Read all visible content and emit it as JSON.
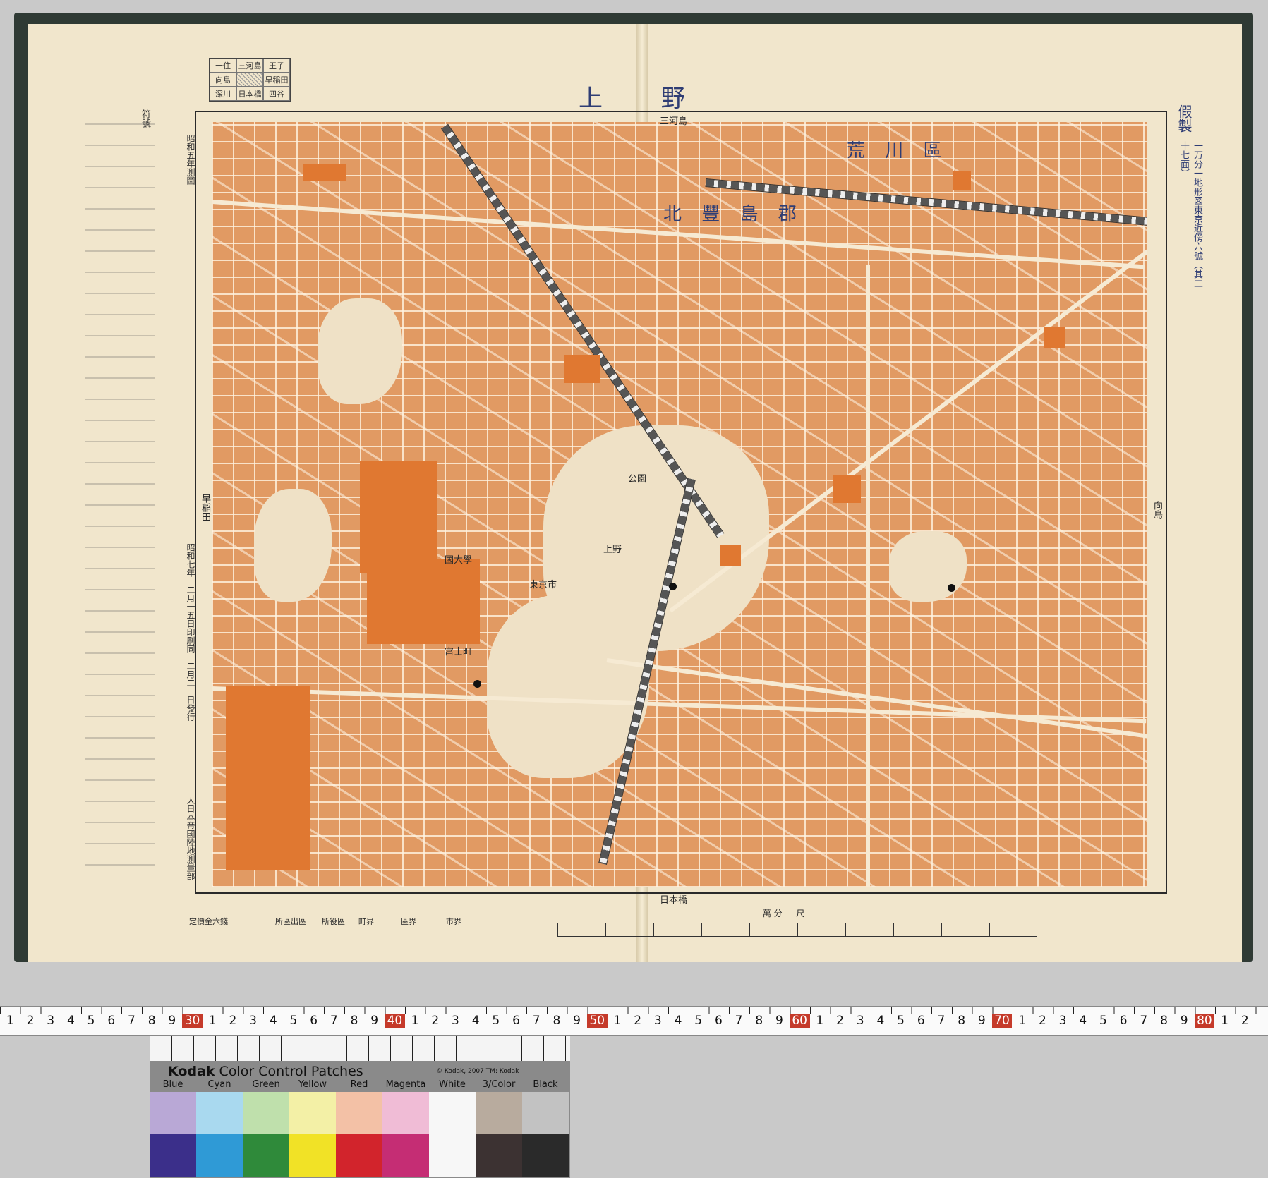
{
  "map": {
    "title": "上 野",
    "subtitle": "一万分一地形図東京近傍六號（其二十七面）",
    "header_right": "假製",
    "edge_labels": {
      "top": "三河島",
      "bottom": "日本橋",
      "left": "早稲田",
      "right": "向島"
    },
    "ward_labels": [
      "荒 川 區",
      "北 豐 島 郡"
    ],
    "district_labels": [
      "東京市",
      "上野",
      "公園",
      "富士町",
      "國大學"
    ],
    "publisher": "大日本帝國陸地測量部",
    "survey_note": "昭和五年測圖",
    "print_note": "昭和七年十二月十五日印刷同十二月二十日發行",
    "price_note": "定價金六錢",
    "scale_label": "一 萬 分 一 尺",
    "index_cells": [
      "十住",
      "三河島",
      "王子",
      "向島",
      "",
      "早稲田",
      "深川",
      "日本橋",
      "四谷"
    ],
    "legend_header": "符號",
    "bottom_legend": [
      "市界",
      "區界",
      "町界",
      "所役區",
      "所區出區"
    ]
  },
  "ruler": {
    "numbers": [
      "1",
      "2",
      "3",
      "4",
      "5",
      "6",
      "7",
      "8",
      "9",
      "30",
      "1",
      "2",
      "3",
      "4",
      "5",
      "6",
      "7",
      "8",
      "9",
      "40",
      "1",
      "2",
      "3",
      "4",
      "5",
      "6",
      "7",
      "8",
      "9",
      "50",
      "1",
      "2",
      "3",
      "4",
      "5",
      "6",
      "7",
      "8",
      "9",
      "60",
      "1",
      "2",
      "3",
      "4",
      "5",
      "6",
      "7",
      "8",
      "9",
      "70",
      "1",
      "2",
      "3",
      "4",
      "5",
      "6",
      "7",
      "8",
      "9",
      "80",
      "1",
      "2"
    ]
  },
  "kodak": {
    "brand": "Kodak",
    "product": "Color Control Patches",
    "copyright": "© Kodak, 2007 TM: Kodak",
    "patches": [
      {
        "name": "Blue",
        "light": "#b9a8d6",
        "dark": "#3b2f8a"
      },
      {
        "name": "Cyan",
        "light": "#a9d9ef",
        "dark": "#2f9ad6"
      },
      {
        "name": "Green",
        "light": "#bfe0ac",
        "dark": "#2f8a3a"
      },
      {
        "name": "Yellow",
        "light": "#f3f0a6",
        "dark": "#f1e226"
      },
      {
        "name": "Red",
        "light": "#f3c1a6",
        "dark": "#d2242c"
      },
      {
        "name": "Magenta",
        "light": "#f0bcd6",
        "dark": "#c52d74"
      },
      {
        "name": "White",
        "light": "#f7f7f7",
        "dark": "#f7f7f7"
      },
      {
        "name": "3/Color",
        "light": "#b8ab9e",
        "dark": "#3c3232"
      },
      {
        "name": "Black",
        "light": "#c2c2c2",
        "dark": "#2a2a2a"
      }
    ]
  }
}
